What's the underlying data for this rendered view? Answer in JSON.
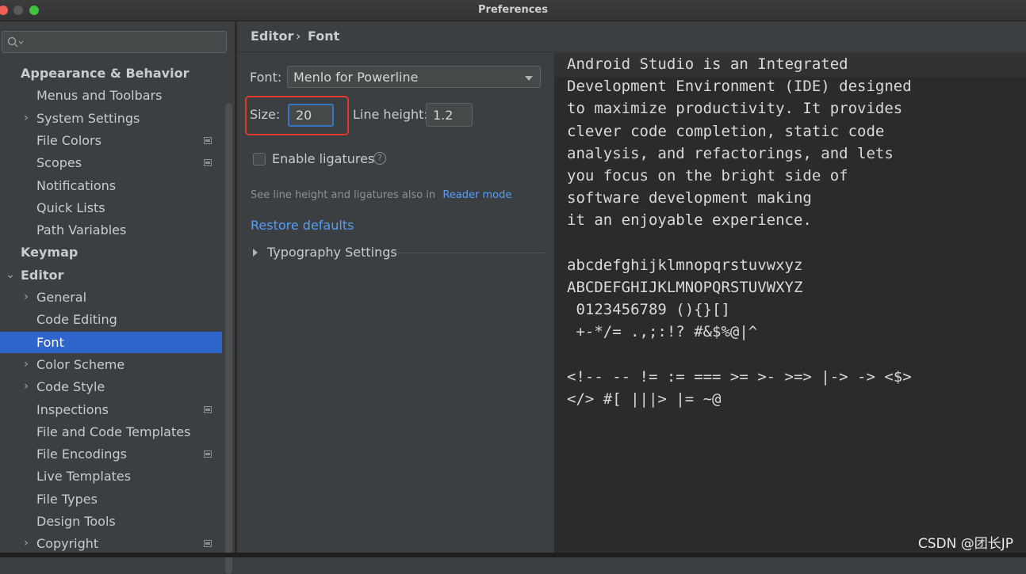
{
  "window": {
    "title": "Preferences"
  },
  "search": {
    "placeholder": ""
  },
  "sidebar": {
    "items": [
      {
        "label": "Appearance & Behavior",
        "bold": true,
        "level": 0,
        "chevron": ""
      },
      {
        "label": "Menus and Toolbars",
        "level": 1,
        "chevron": ""
      },
      {
        "label": "System Settings",
        "level": 1,
        "chevron": "›"
      },
      {
        "label": "File Colors",
        "level": 1,
        "chevron": "",
        "project": true
      },
      {
        "label": "Scopes",
        "level": 1,
        "chevron": "",
        "project": true
      },
      {
        "label": "Notifications",
        "level": 1,
        "chevron": ""
      },
      {
        "label": "Quick Lists",
        "level": 1,
        "chevron": ""
      },
      {
        "label": "Path Variables",
        "level": 1,
        "chevron": ""
      },
      {
        "label": "Keymap",
        "bold": true,
        "level": 0,
        "chevron": ""
      },
      {
        "label": "Editor",
        "bold": true,
        "level": 0,
        "chevron": "⌄"
      },
      {
        "label": "General",
        "level": 1,
        "chevron": "›"
      },
      {
        "label": "Code Editing",
        "level": 1,
        "chevron": ""
      },
      {
        "label": "Font",
        "level": 1,
        "chevron": "",
        "selected": true
      },
      {
        "label": "Color Scheme",
        "level": 1,
        "chevron": "›"
      },
      {
        "label": "Code Style",
        "level": 1,
        "chevron": "›"
      },
      {
        "label": "Inspections",
        "level": 1,
        "chevron": "",
        "project": true
      },
      {
        "label": "File and Code Templates",
        "level": 1,
        "chevron": ""
      },
      {
        "label": "File Encodings",
        "level": 1,
        "chevron": "",
        "project": true
      },
      {
        "label": "Live Templates",
        "level": 1,
        "chevron": ""
      },
      {
        "label": "File Types",
        "level": 1,
        "chevron": ""
      },
      {
        "label": "Design Tools",
        "level": 1,
        "chevron": ""
      },
      {
        "label": "Copyright",
        "level": 1,
        "chevron": "›",
        "project": true
      }
    ]
  },
  "breadcrumb": {
    "parent": "Editor",
    "separator": "›",
    "current": "Font"
  },
  "font": {
    "font_label": "Font:",
    "font_value": "Menlo for Powerline",
    "size_label": "Size:",
    "size_value": "20",
    "line_height_label": "Line height:",
    "line_height_value": "1.2",
    "ligatures_label": "Enable ligatures",
    "ligatures_checked": false,
    "help_glyph": "?",
    "hint_text": "See line height and ligatures also in",
    "hint_link": "Reader mode",
    "restore_label": "Restore defaults",
    "typography_label": "Typography Settings"
  },
  "preview": {
    "lines": [
      "Android Studio is an Integrated",
      "Development Environment (IDE) designed",
      "to maximize productivity. It provides",
      "clever code completion, static code",
      "analysis, and refactorings, and lets",
      "you focus on the bright side of",
      "software development making",
      "it an enjoyable experience.",
      "",
      "abcdefghijklmnopqrstuvwxyz",
      "ABCDEFGHIJKLMNOPQRSTUVWXYZ",
      " 0123456789 (){}[]",
      " +-*/= .,;:!? #&$%@|^",
      "",
      "<!-- -- != := === >= >- >=> |-> -> <$>",
      "</> #[ |||> |= ~@"
    ]
  },
  "watermark": "CSDN @团长JP",
  "colors": {
    "selection": "#2f65ca",
    "link": "#589df6",
    "highlight_box": "#e0392b"
  }
}
